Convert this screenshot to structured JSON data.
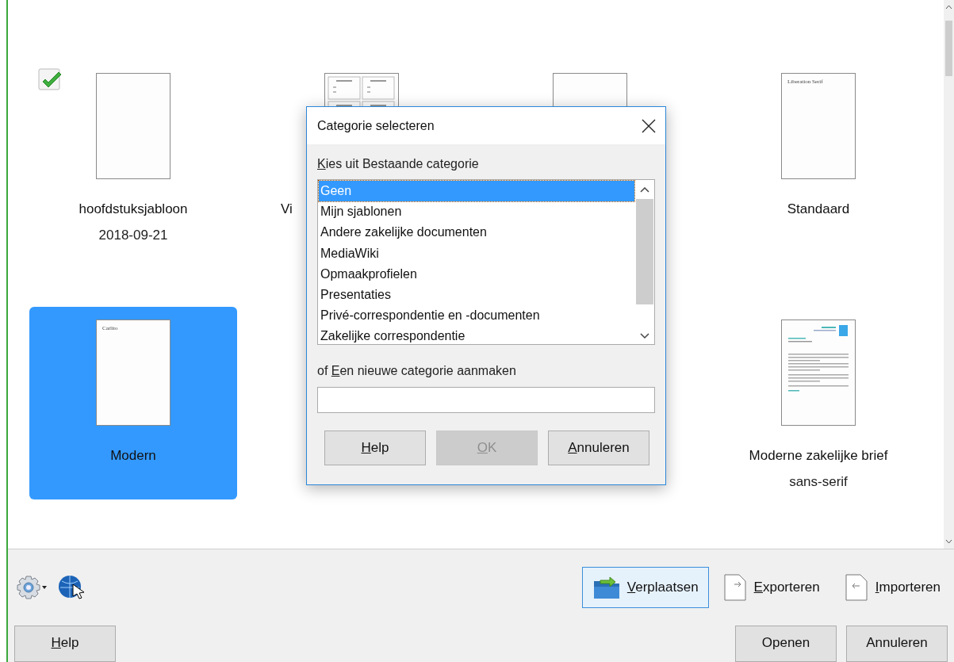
{
  "templates": {
    "rows": [
      {
        "items": [
          {
            "title": "hoofdstuksjabloon",
            "date": "2018-09-21",
            "kind": "blank",
            "selected": false,
            "default": true
          },
          {
            "title": "Vi",
            "label_cut": true,
            "kind": "grid",
            "selected": false,
            "default": false
          },
          {
            "kind": "blank",
            "selected": false,
            "default": false
          },
          {
            "title": "Standaard",
            "kind": "text",
            "preview_text": "Liberation Serif",
            "selected": false,
            "default": false
          }
        ]
      },
      {
        "items": [
          {
            "title": "Modern",
            "kind": "text",
            "preview_text": "Carlito",
            "selected": true,
            "default": false
          },
          {
            "kind": "covered"
          },
          {
            "kind": "covered"
          },
          {
            "title": "Moderne zakelijke brief",
            "date": "sans-serif",
            "kind": "letter",
            "selected": false,
            "default": false
          }
        ]
      }
    ]
  },
  "dialog": {
    "title": "Categorie selecteren",
    "existing_label": "Kies uit Bestaande categorie",
    "categories": [
      {
        "label": "Geen",
        "selected": true
      },
      {
        "label": "Mijn sjablonen",
        "selected": false
      },
      {
        "label": "Andere zakelijke documenten",
        "selected": false
      },
      {
        "label": "MediaWiki",
        "selected": false
      },
      {
        "label": "Opmaakprofielen",
        "selected": false
      },
      {
        "label": "Presentaties",
        "selected": false
      },
      {
        "label": "Privé-correspondentie en -documenten",
        "selected": false
      },
      {
        "label": "Zakelijke correspondentie",
        "selected": false
      }
    ],
    "new_label": "of Een nieuwe categorie aanmaken",
    "buttons": [
      {
        "label": "Help",
        "disabled": false
      },
      {
        "label": "OK",
        "disabled": true
      },
      {
        "label": "Annuleren",
        "disabled": false
      }
    ]
  },
  "toolbar": {
    "actions": [
      {
        "label": "Verplaatsen",
        "kind": "move",
        "pressed": true
      },
      {
        "label": "Exporteren",
        "kind": "export",
        "pressed": false
      },
      {
        "label": "Importeren",
        "kind": "import",
        "pressed": false
      }
    ]
  },
  "buttons": {
    "left": [
      {
        "label": "Help",
        "mnemonic": true
      }
    ],
    "right": [
      {
        "label": "Openen",
        "mnemonic": false
      },
      {
        "label": "Annuleren",
        "mnemonic": false
      }
    ]
  }
}
